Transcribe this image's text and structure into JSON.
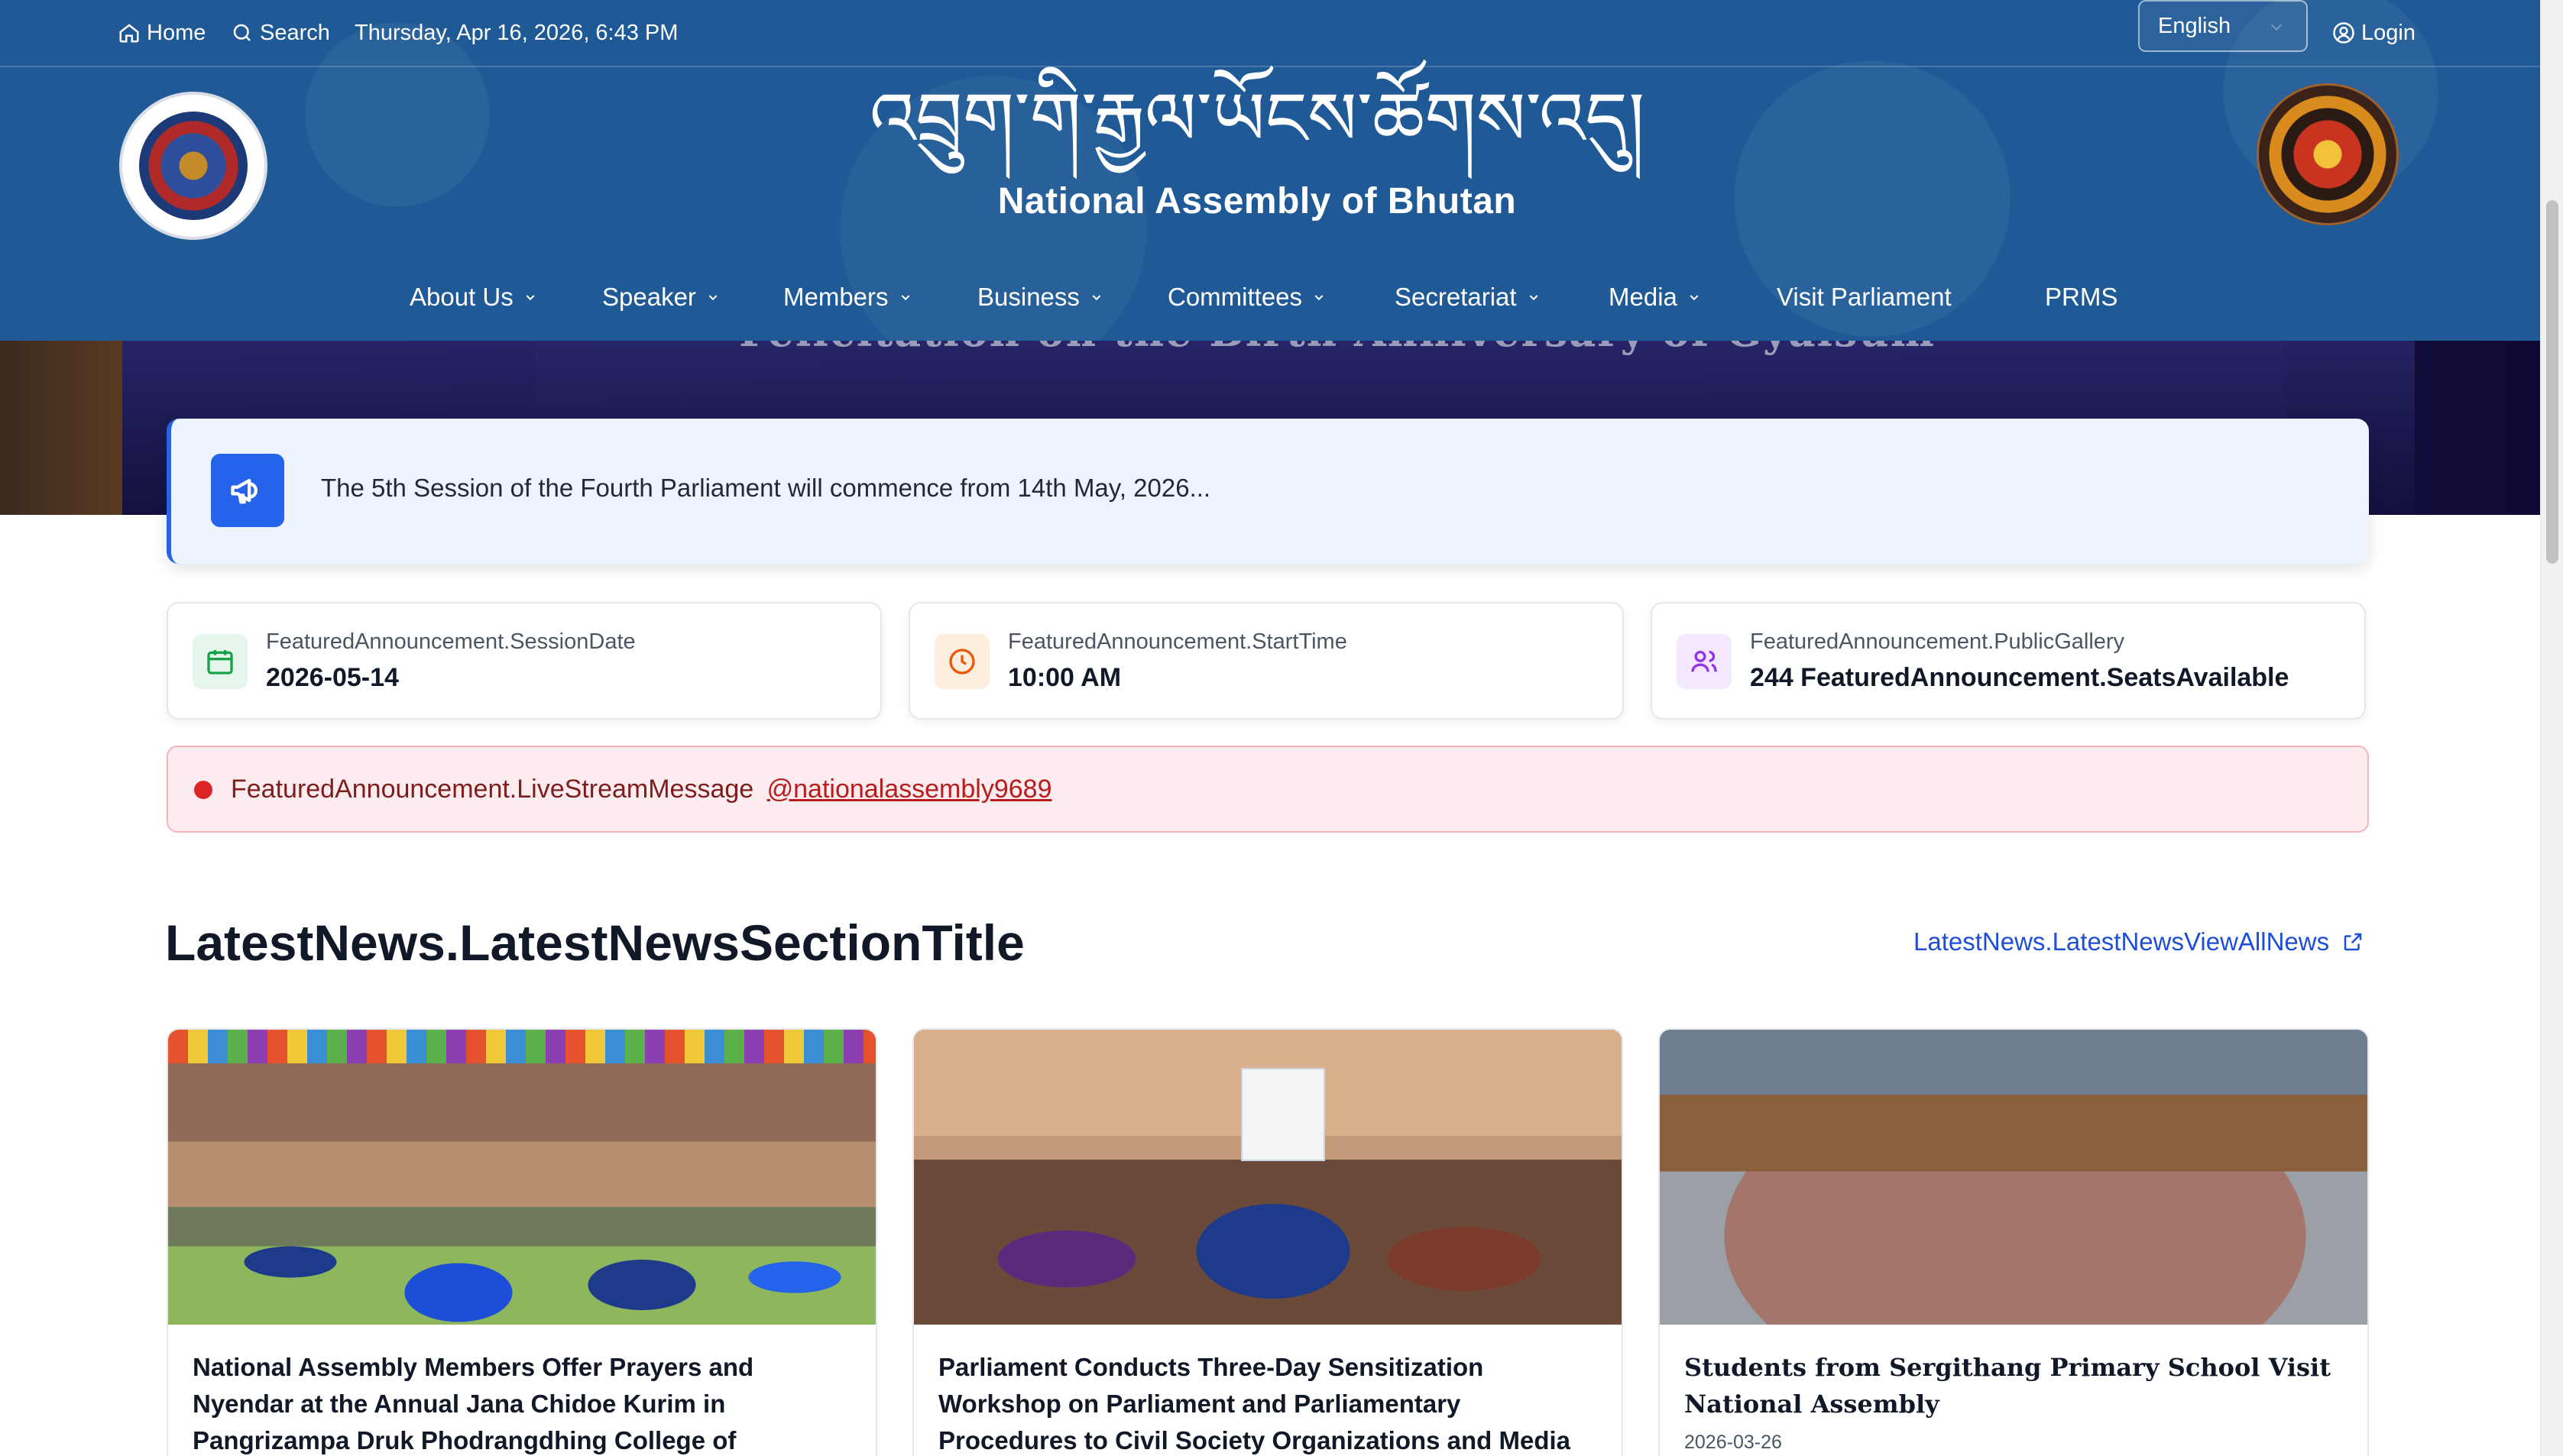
{
  "topbar": {
    "home": "Home",
    "search": "Search",
    "datetime": "Thursday, Apr 16, 2026, 6:43 PM",
    "language": "English",
    "login": "Login"
  },
  "header": {
    "title_dz": "འབྲུག་གི་རྒྱལ་ཡོངས་ཚོགས་འདུ།",
    "title_en": "National Assembly of Bhutan"
  },
  "nav": {
    "items": [
      {
        "label": "About Us",
        "dropdown": true
      },
      {
        "label": "Speaker",
        "dropdown": true
      },
      {
        "label": "Members",
        "dropdown": true
      },
      {
        "label": "Business",
        "dropdown": true
      },
      {
        "label": "Committees",
        "dropdown": true
      },
      {
        "label": "Secretariat",
        "dropdown": true
      },
      {
        "label": "Media",
        "dropdown": true
      },
      {
        "label": "Visit Parliament",
        "dropdown": false
      },
      {
        "label": "PRMS",
        "dropdown": false
      }
    ]
  },
  "hero": {
    "caption": "Felicitation on the Birth Anniversary of Gyalsum"
  },
  "announcement": {
    "text": "The 5th Session of the Fourth Parliament will commence from 14th May, 2026..."
  },
  "info_cards": [
    {
      "label": "FeaturedAnnouncement.SessionDate",
      "value": "2026-05-14",
      "icon": "calendar-icon",
      "color": "#16a34a",
      "bg": "#e7f6ec"
    },
    {
      "label": "FeaturedAnnouncement.StartTime",
      "value": "10:00 AM",
      "icon": "clock-icon",
      "color": "#ea580c",
      "bg": "#fdeedd"
    },
    {
      "label": "FeaturedAnnouncement.PublicGallery",
      "value": "244 FeaturedAnnouncement.SeatsAvailable",
      "icon": "users-icon",
      "color": "#9333ea",
      "bg": "#f3e8fd"
    }
  ],
  "live": {
    "message": "FeaturedAnnouncement.LiveStreamMessage",
    "handle": "@nationalassembly9689"
  },
  "latest_news": {
    "title": "LatestNews.LatestNewsSectionTitle",
    "view_all": "LatestNews.LatestNewsViewAllNews",
    "items": [
      {
        "headline": "National Assembly Members Offer Prayers and Nyendar at the Annual Jana Chidoe Kurim in Pangrizampa Druk Phodrangdhing College of Astrology",
        "date": ""
      },
      {
        "headline": "Parliament Conducts Three-Day Sensitization Workshop on Parliament and Parliamentary Procedures to Civil Society Organizations and Media",
        "date": ""
      },
      {
        "headline": "Students from Sergithang Primary School Visit National Assembly",
        "date": "2026-03-26"
      }
    ]
  },
  "colors": {
    "header_bg": "#1f5a96",
    "accent": "#2563eb",
    "live_bg": "#fdecef",
    "live_dot": "#dc2626"
  }
}
